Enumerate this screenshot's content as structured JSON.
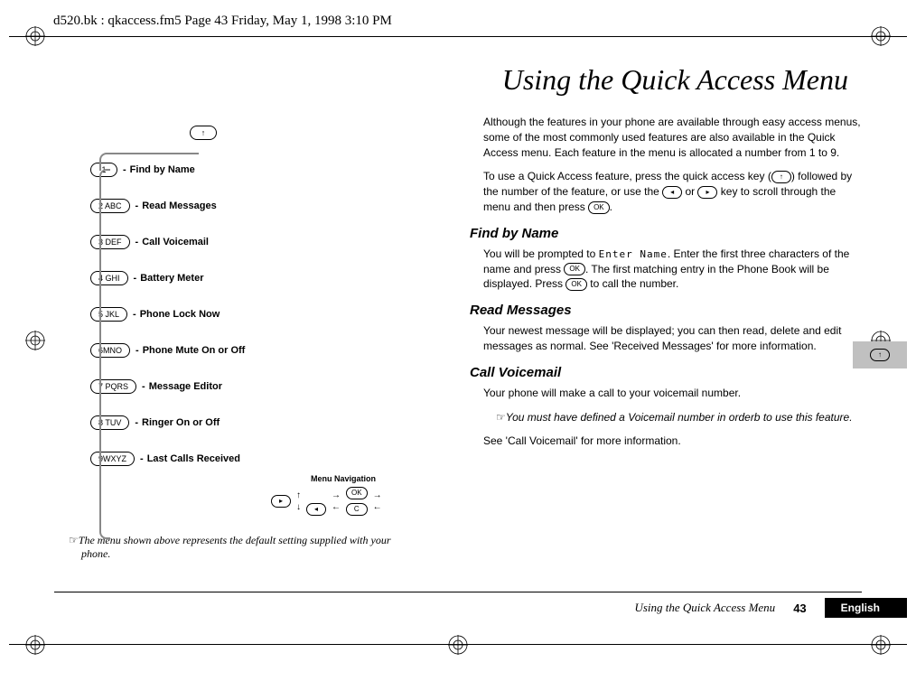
{
  "header_path": "d520.bk : qkaccess.fm5  Page 43  Friday, May 1, 1998  3:10 PM",
  "title": "Using the Quick Access Menu",
  "menu_top_key": "↑",
  "menu_items": [
    {
      "key": "1    ",
      "label": "Find by Name"
    },
    {
      "key": "2 ABC",
      "label": "Read Messages"
    },
    {
      "key": "3 DEF",
      "label": "Call Voicemail"
    },
    {
      "key": "4 GHI",
      "label": "Battery Meter"
    },
    {
      "key": "5 JKL",
      "label": "Phone Lock Now"
    },
    {
      "key": "6MNO",
      "label": "Phone Mute On or Off"
    },
    {
      "key": "7 PQRS",
      "label": "Message Editor"
    },
    {
      "key": "8 TUV",
      "label": "Ringer On or Off"
    },
    {
      "key": "9WXYZ",
      "label": "Last Calls Received"
    }
  ],
  "nav": {
    "title": "Menu Navigation",
    "ok": "OK",
    "c": "C",
    "left": "◂",
    "right": "▸"
  },
  "caption": "The menu shown above represents the default setting supplied with your phone.",
  "intro": {
    "p1": "Although the features in your phone are available through easy access menus, some of the most commonly used features are also available in the Quick Access menu. Each feature in the menu is allocated a number from 1 to 9.",
    "p2a": "To use a Quick Access feature, press the quick access key (",
    "p2b": ") followed by the number of the feature, or use the ",
    "p2c": " or ",
    "p2d": " key to scroll through the menu and then press ",
    "p2e": "."
  },
  "sections": [
    {
      "heading": "Find by Name",
      "body_a": "You will be prompted to ",
      "lcd": "Enter Name",
      "body_b": ". Enter the first three characters of the name and press ",
      "body_c": ". The first matching entry in the Phone Book will be displayed. Press ",
      "body_d": " to call the number."
    },
    {
      "heading": "Read Messages",
      "body": "Your newest message will be displayed; you can then read, delete and edit messages as normal. See 'Received Messages' for more information."
    },
    {
      "heading": "Call Voicemail",
      "body": "Your phone will make a call to your voicemail number.",
      "note": "You must have defined a Voicemail number in orderb to use this feature.",
      "body2": "See 'Call Voicemail' for more information."
    }
  ],
  "side_tab_key": "↑",
  "keys": {
    "ok": "OK",
    "up": "↑",
    "left": "◂",
    "right": "▸"
  },
  "footer": {
    "title": "Using the Quick Access Menu",
    "page": "43",
    "lang": "English"
  },
  "hand_symbol": "☞"
}
